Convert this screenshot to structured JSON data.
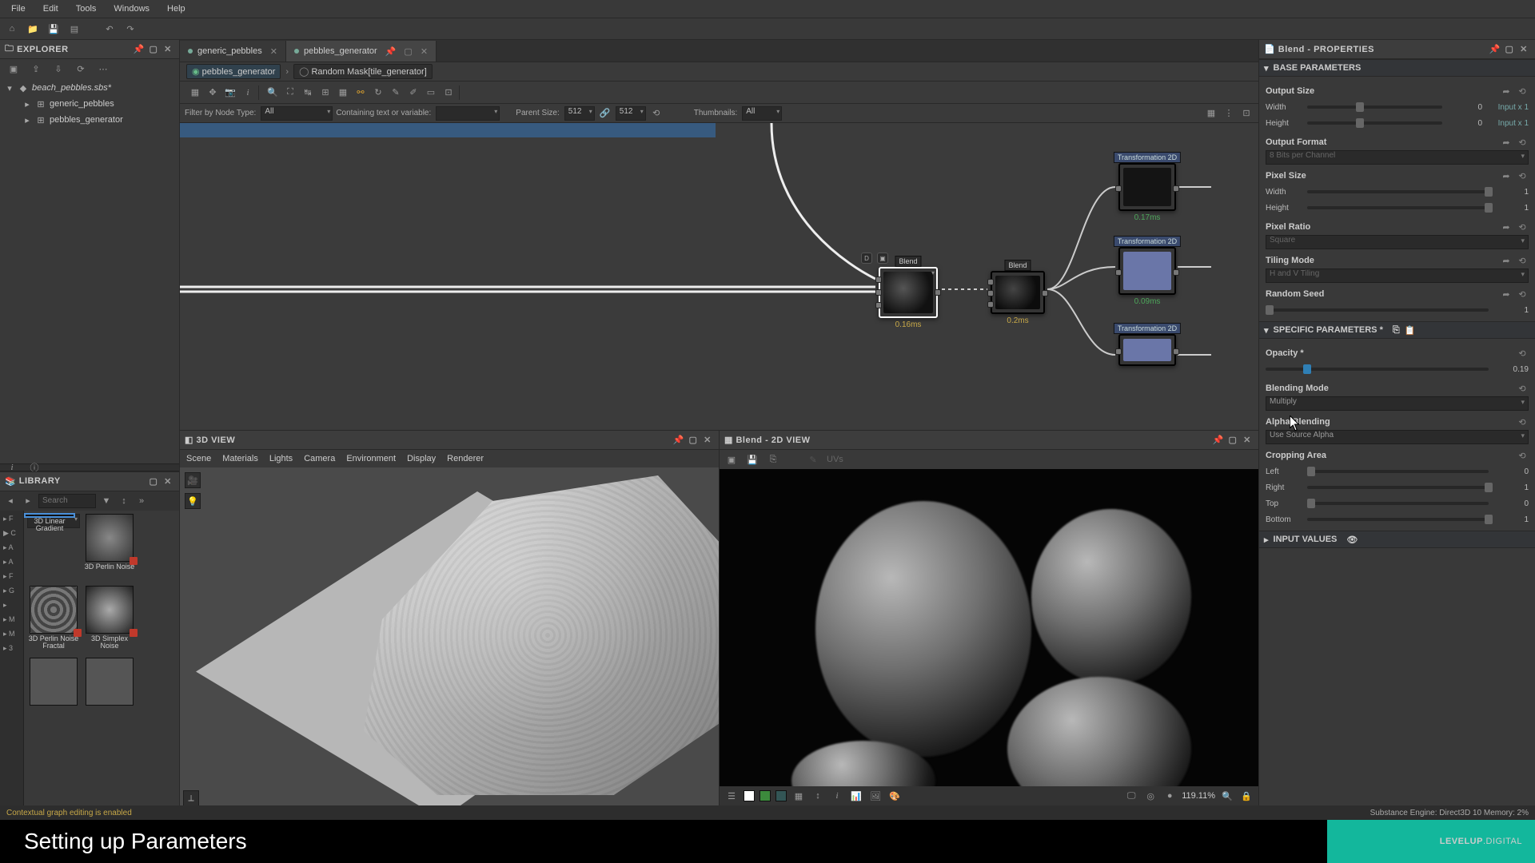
{
  "menubar": [
    "File",
    "Edit",
    "Tools",
    "Windows",
    "Help"
  ],
  "explorer": {
    "title": "EXPLORER",
    "root": "beach_pebbles.sbs*",
    "children": [
      "generic_pebbles",
      "pebbles_generator"
    ]
  },
  "tabs": [
    {
      "label": "generic_pebbles",
      "active": false
    },
    {
      "label": "pebbles_generator",
      "active": true
    }
  ],
  "crumbs": [
    "pebbles_generator",
    "Random Mask[tile_generator]"
  ],
  "graph_tb": {
    "filter_label": "Filter by Node Type:",
    "filter_value": "All",
    "contain_label": "Containing text or variable:",
    "contain_value": "",
    "parent_label": "Parent Size:",
    "parent_x": "512",
    "parent_y": "512",
    "thumb_label": "Thumbnails:",
    "thumb_value": "All"
  },
  "nodes": {
    "t1": {
      "title": "Transformation 2D",
      "timing": "0.17ms"
    },
    "t2": {
      "title": "Transformation 2D",
      "timing": "0.09ms"
    },
    "t3": {
      "title": "Transformation 2D",
      "timing": ""
    },
    "b1": {
      "title": "Blend",
      "timing": "0.16ms"
    },
    "b2": {
      "title": "Blend",
      "timing": "0.2ms"
    }
  },
  "view3d": {
    "title": "3D VIEW",
    "menu": [
      "Scene",
      "Materials",
      "Lights",
      "Camera",
      "Environment",
      "Display",
      "Renderer"
    ]
  },
  "view2d": {
    "title": "Blend - 2D VIEW",
    "uvs": "UVs",
    "zoom": "119.11%"
  },
  "library": {
    "title": "LIBRARY",
    "search_ph": "Search",
    "cats": [
      "▸ F",
      "▶ C",
      "▸ A",
      "▸ A",
      "▸ F",
      "▸ G",
      "▸  ",
      "▸ M",
      "▸ M",
      "▸ 3"
    ],
    "items": [
      {
        "name": "3D Linear Gradient"
      },
      {
        "name": "3D Perlin Noise"
      },
      {
        "name": "3D Perlin Noise Fractal"
      },
      {
        "name": "3D Simplex Noise"
      }
    ]
  },
  "props": {
    "title": "Blend - PROPERTIES",
    "base_hdr": "BASE PARAMETERS",
    "output_size": "Output Size",
    "width": "Width",
    "height": "Height",
    "width_v": "0",
    "height_v": "0",
    "width_link": "Input x 1",
    "height_link": "Input x 1",
    "output_format": "Output Format",
    "output_format_v": "8 Bits per Channel",
    "pixel_size": "Pixel Size",
    "ps_w": "1",
    "ps_h": "1",
    "pixel_ratio": "Pixel Ratio",
    "pixel_ratio_v": "Square",
    "tiling": "Tiling Mode",
    "tiling_v": "H and V Tiling",
    "random_seed": "Random Seed",
    "random_seed_v": "1",
    "spec_hdr": "SPECIFIC PARAMETERS *",
    "opacity": "Opacity *",
    "opacity_v": "0.19",
    "blend_mode": "Blending Mode",
    "blend_mode_v": "Multiply",
    "alpha": "Alpha Blending",
    "alpha_v": "Use Source Alpha",
    "crop": "Cropping Area",
    "left": "Left",
    "right": "Right",
    "top": "Top",
    "bottom": "Bottom",
    "left_v": "0",
    "right_v": "1",
    "top_v": "0",
    "bottom_v": "1",
    "input_hdr": "INPUT VALUES"
  },
  "status": {
    "msg": "Contextual graph editing is enabled",
    "engine": "Substance Engine: Direct3D 10   Memory: 2%"
  },
  "caption": "Setting up Parameters",
  "brand_a": "LEVELUP",
  "brand_b": ".DIGITAL"
}
